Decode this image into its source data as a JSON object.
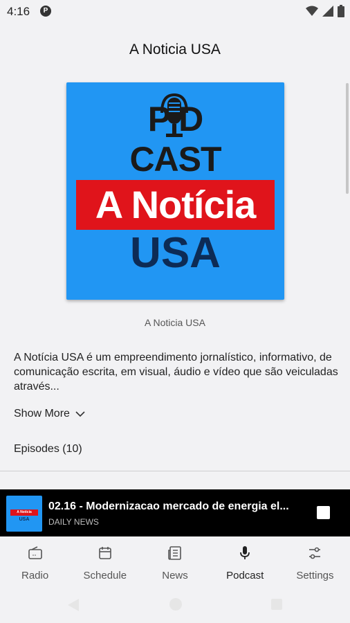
{
  "status_bar": {
    "time": "4:16",
    "app_icon_letter": "P"
  },
  "header": {
    "title": "A Noticia USA"
  },
  "cover": {
    "line1": "PODCAST",
    "pod": "P  D",
    "cast": "CAST",
    "noticia": "A Notícia",
    "usa": "USA"
  },
  "caption": "A Noticia USA",
  "description": "A Notícia USA é um empreendimento jornalístico, informativo, de comunicação escrita, em visual, áudio e vídeo que são veiculadas através...",
  "show_more_label": "Show More",
  "episodes_label": "Episodes (10)",
  "player": {
    "title": "02.16 - Modernizacao mercado de energia el...",
    "subtitle": "DAILY NEWS",
    "thumb_band": "A Notícia",
    "thumb_usa": "USA"
  },
  "bottom_nav": [
    {
      "label": "Radio",
      "icon": "radio-icon"
    },
    {
      "label": "Schedule",
      "icon": "calendar-icon"
    },
    {
      "label": "News",
      "icon": "newspaper-icon"
    },
    {
      "label": "Podcast",
      "icon": "microphone-icon",
      "active": true
    },
    {
      "label": "Settings",
      "icon": "sliders-icon"
    }
  ],
  "colors": {
    "cover_blue": "#2196f3",
    "cover_red": "#e0141b",
    "cover_navy": "#0d2b55",
    "player_bg": "#000000"
  }
}
